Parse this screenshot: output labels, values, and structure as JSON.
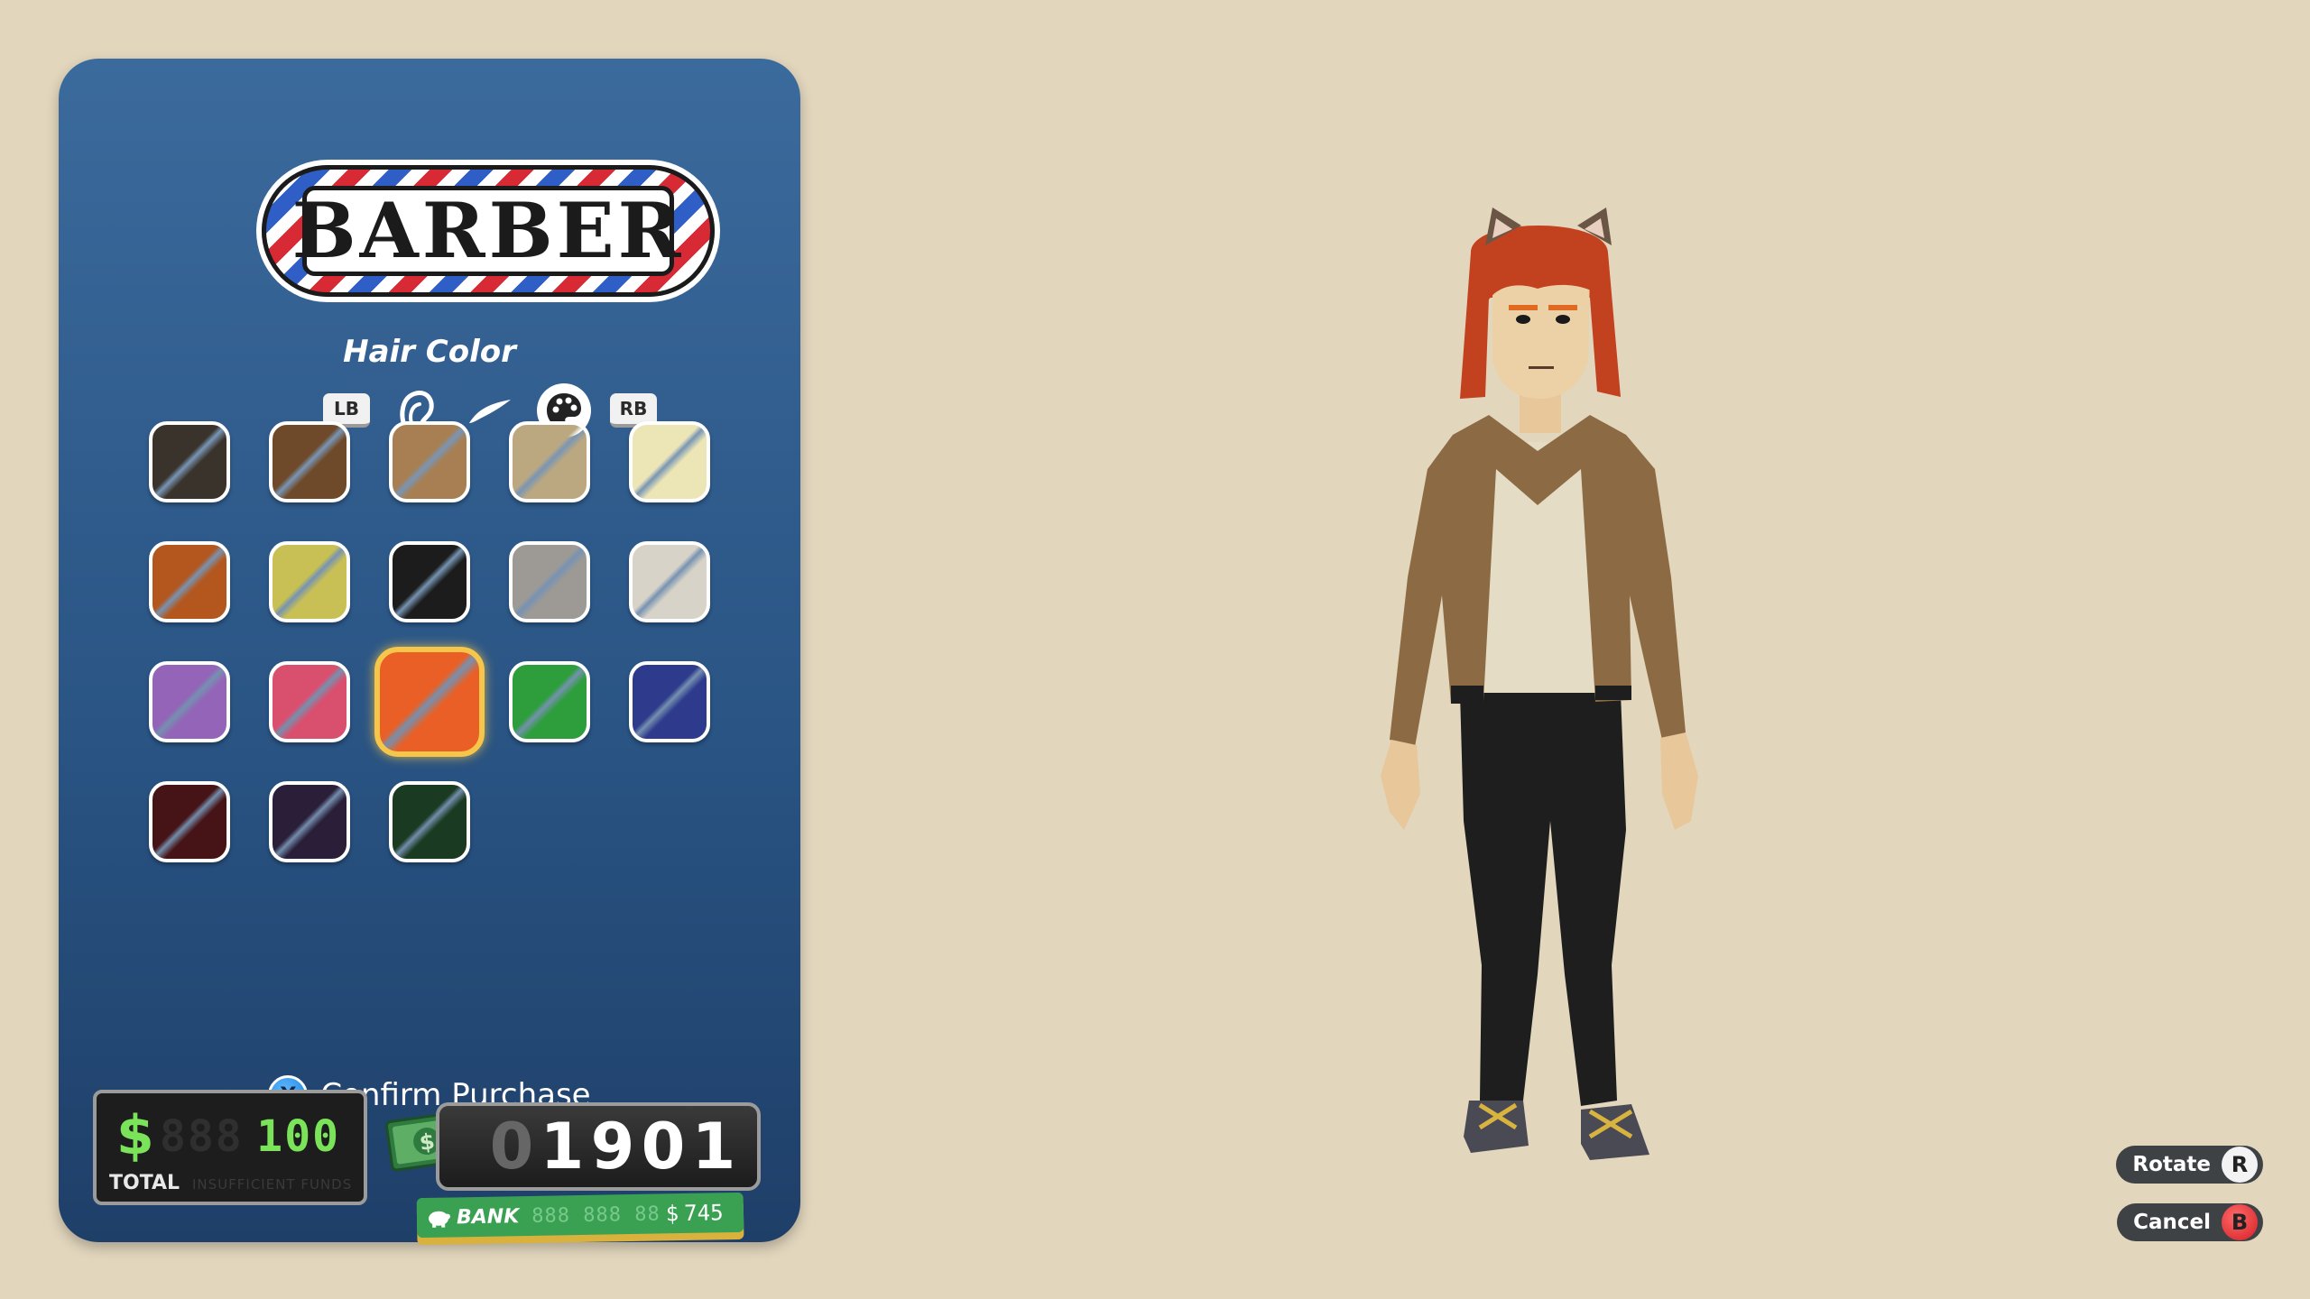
{
  "shop": {
    "title": "BARBER"
  },
  "section": {
    "title": "Hair Color"
  },
  "tabs": {
    "left_bumper": "LB",
    "right_bumper": "RB",
    "icons": [
      "hairstyle-icon",
      "eyebrow-icon",
      "palette-icon"
    ],
    "active_icon": "palette-icon"
  },
  "swatches": [
    [
      "#3a332b",
      "#6e4a2a",
      "#a77f52",
      "#bca880",
      "#ece6b6"
    ],
    [
      "#b3571f",
      "#c8c055",
      "#1c1c1c",
      "#9d9a96",
      "#d8d3c8"
    ],
    [
      "#9464b8",
      "#d9506f",
      "#ea5f25",
      "#2e9e3c",
      "#2e3a8c"
    ],
    [
      "#461416",
      "#2a1e38",
      "#1a3a22"
    ]
  ],
  "selected_swatch": "#ea5f25",
  "confirm": {
    "button": "X",
    "label": "Confirm Purchase"
  },
  "total": {
    "currency": "$",
    "value": "100",
    "label": "TOTAL",
    "note": "INSUFFICIENT FUNDS"
  },
  "cash": {
    "digits": [
      "0",
      "1",
      "9",
      "0",
      "1"
    ]
  },
  "bank": {
    "label": "BANK",
    "currency": "$",
    "value": "745"
  },
  "hints": {
    "rotate": {
      "label": "Rotate",
      "button": "R"
    },
    "cancel": {
      "label": "Cancel",
      "button": "B"
    }
  }
}
